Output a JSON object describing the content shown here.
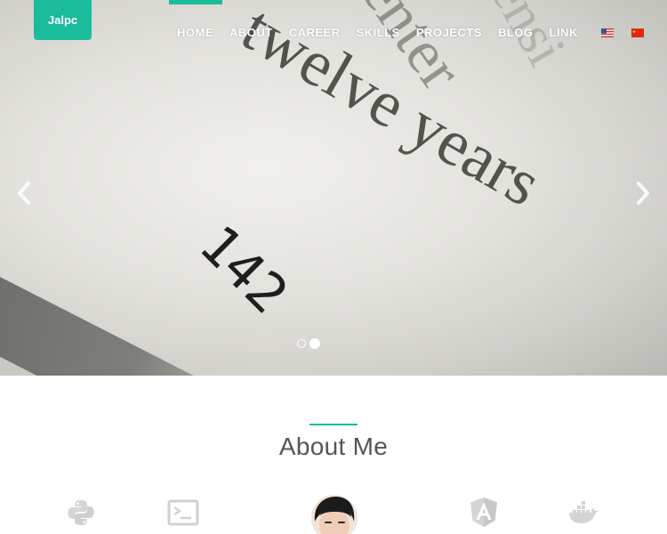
{
  "brand": {
    "label": "Jalpc"
  },
  "nav": {
    "items": [
      {
        "label": "HOME"
      },
      {
        "label": "ABOUT"
      },
      {
        "label": "CAREER"
      },
      {
        "label": "SKILLS"
      },
      {
        "label": "PROJECTS"
      },
      {
        "label": "BLOG"
      },
      {
        "label": "LINK"
      }
    ],
    "languages": [
      "en-us-flag-icon",
      "zh-cn-flag-icon"
    ],
    "accent_color": "#1abc9c"
  },
  "hero": {
    "slides_count": 2,
    "active_slide": 2,
    "icons": {
      "prev": "chevron-left-icon",
      "next": "chevron-right-icon"
    }
  },
  "about": {
    "title": "About Me",
    "icons": [
      "python-icon",
      "terminal-icon",
      "avatar",
      "angular-icon",
      "docker-icon"
    ]
  }
}
